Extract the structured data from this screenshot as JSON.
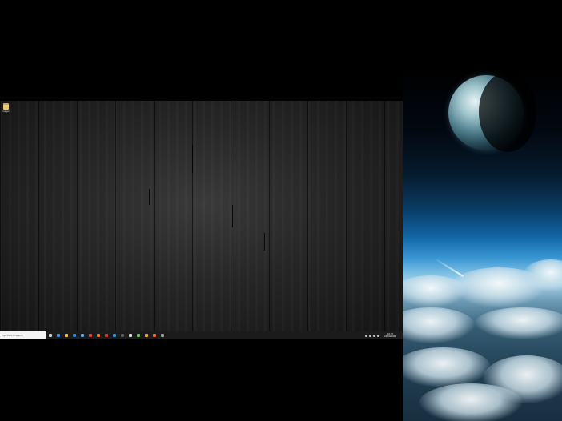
{
  "desktop": {
    "icons": [
      {
        "label": "Imager",
        "icon": "folder-icon"
      }
    ]
  },
  "taskbar": {
    "search_placeholder": "Type here to search",
    "pinned": [
      {
        "name": "task-view",
        "color": "#cfcfcf"
      },
      {
        "name": "edge",
        "color": "#3a8ee6"
      },
      {
        "name": "file-explorer",
        "color": "#f0c24b"
      },
      {
        "name": "mail",
        "color": "#2f7fd1"
      },
      {
        "name": "store",
        "color": "#5aa0e0"
      },
      {
        "name": "chrome",
        "color": "#db4437"
      },
      {
        "name": "firefox",
        "color": "#f0772b"
      },
      {
        "name": "app-red",
        "color": "#c33c3c"
      },
      {
        "name": "vscode",
        "color": "#2d8fe0"
      },
      {
        "name": "app-dark",
        "color": "#5a5a5a"
      },
      {
        "name": "notepad",
        "color": "#dadada"
      },
      {
        "name": "app-green",
        "color": "#6fbf5a"
      },
      {
        "name": "paint",
        "color": "#f2a93b"
      },
      {
        "name": "app-orange",
        "color": "#e8682c"
      },
      {
        "name": "settings",
        "color": "#9a9a9a"
      }
    ],
    "clock": {
      "time": "10:27",
      "date": "22/09/2023"
    },
    "tray_icons": [
      "chevron-up-icon",
      "network-icon",
      "volume-icon",
      "keyboard-icon"
    ]
  },
  "colors": {
    "taskbar_bg": "#1b1b1b",
    "search_bg": "#f3f3f3"
  }
}
